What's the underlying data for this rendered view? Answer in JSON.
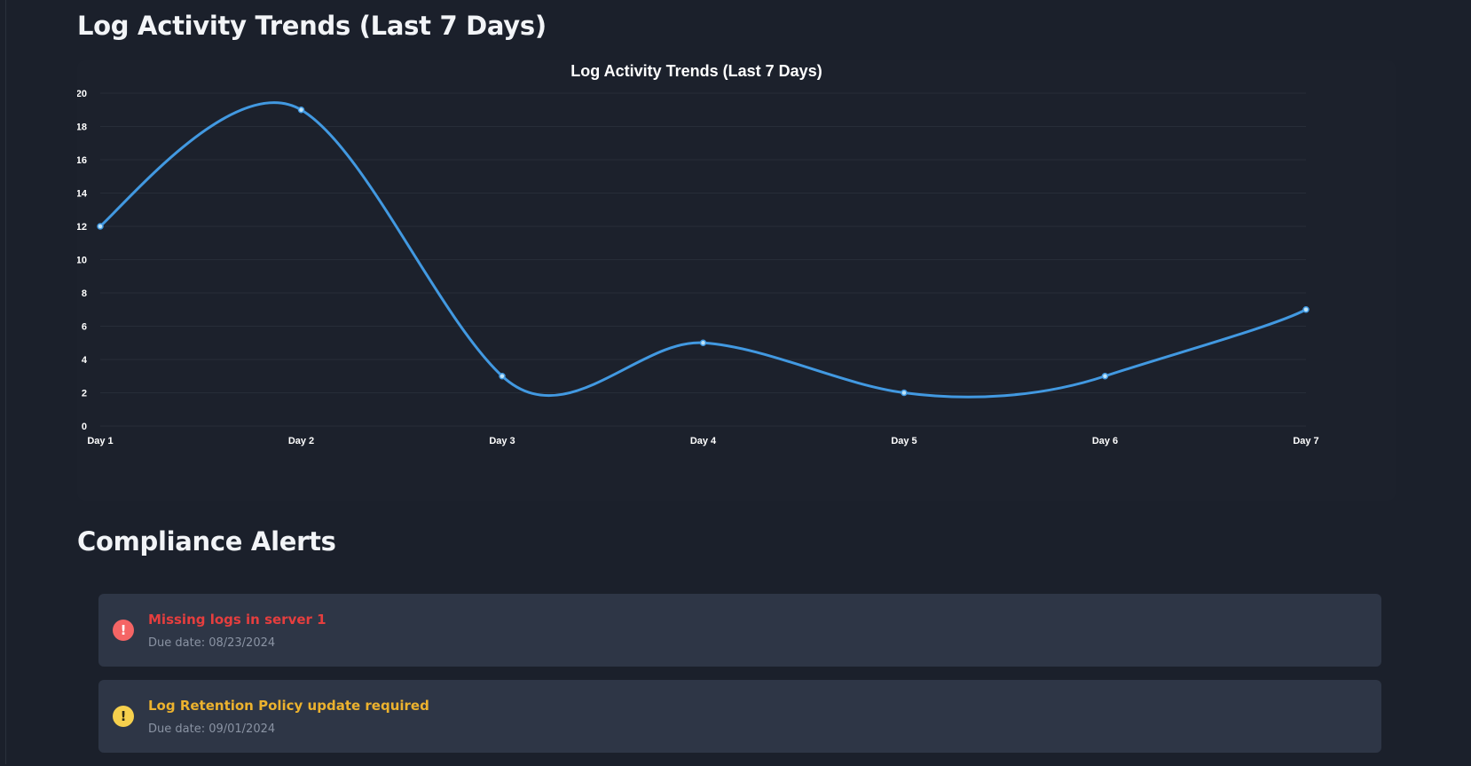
{
  "sections": {
    "trend_title": "Log Activity Trends (Last 7 Days)",
    "alerts_title": "Compliance Alerts"
  },
  "chart_data": {
    "type": "line",
    "title": "Log Activity Trends (Last 7 Days)",
    "xlabel": "",
    "ylabel": "",
    "categories": [
      "Day 1",
      "Day 2",
      "Day 3",
      "Day 4",
      "Day 5",
      "Day 6",
      "Day 7"
    ],
    "values": [
      12,
      19,
      3,
      5,
      2,
      3,
      7
    ],
    "ylim": [
      0,
      20
    ],
    "yticks": [
      0,
      2,
      4,
      6,
      8,
      10,
      12,
      14,
      16,
      18,
      20
    ],
    "grid": true,
    "curve": "smooth",
    "line_color": "#4299e1",
    "point_fill": "#bee3f8"
  },
  "alerts": [
    {
      "title": "Missing logs in server 1",
      "due": "Due date: 08/23/2024",
      "color": "#e53e3e",
      "icon": "exclamation-circle-icon",
      "icon_glyph": "!",
      "icon_bg": "#f56565",
      "icon_fg": "#ffffff"
    },
    {
      "title": "Log Retention Policy update required",
      "due": "Due date: 09/01/2024",
      "color": "#ecb22e",
      "icon": "warning-circle-icon",
      "icon_glyph": "!",
      "icon_bg": "#f6d04d",
      "icon_fg": "#2d2a14"
    }
  ]
}
